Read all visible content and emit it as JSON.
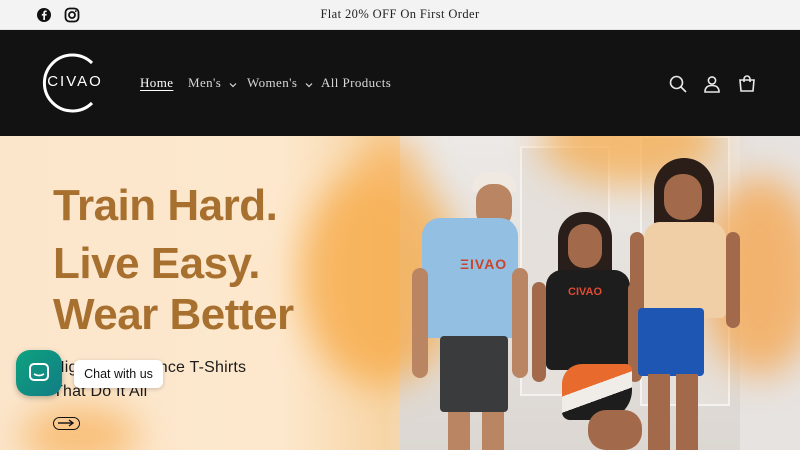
{
  "announcement": {
    "message": "Flat 20% OFF On First Order",
    "social": [
      "facebook-icon",
      "instagram-icon"
    ]
  },
  "header": {
    "logo_text": "CIVAO",
    "nav": [
      {
        "label": "Home",
        "active": true
      },
      {
        "label": "Men's",
        "dropdown": true
      },
      {
        "label": "Women's",
        "dropdown": true
      },
      {
        "label": "All Products"
      }
    ],
    "icons": [
      "search-icon",
      "account-icon",
      "cart-icon"
    ]
  },
  "hero": {
    "headline": [
      "Train Hard.",
      "Live Easy.",
      "Wear Better"
    ],
    "subline": [
      "High Performance T-Shirts",
      "That Do It All"
    ],
    "colors": {
      "headline": "#a8702f",
      "accent_orange": "#f6a64a"
    }
  },
  "chat": {
    "label": "Chat with us",
    "color": "#0da37f"
  }
}
